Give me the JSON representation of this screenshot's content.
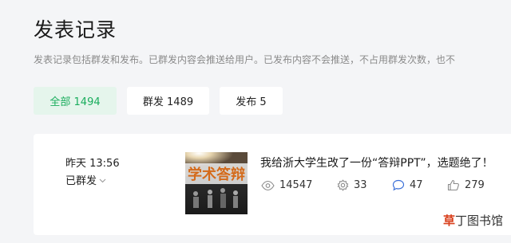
{
  "page": {
    "title": "发表记录",
    "description": "发表记录包括群发和发布。已群发内容会推送给用户。已发布内容不会推送，不占用群发次数，也不"
  },
  "filters": [
    {
      "label": "全部 1494",
      "active": true
    },
    {
      "label": "群发 1489",
      "active": false
    },
    {
      "label": "发布 5",
      "active": false
    }
  ],
  "post": {
    "time": "昨天 13:56",
    "status": "已群发",
    "thumbnail_text": "学术答辩",
    "title": "我给浙大学生改了一份“答辩PPT”，选题绝了！",
    "stats": {
      "reads": "14547",
      "shares": "33",
      "comments": "47",
      "likes": "279"
    }
  },
  "watermark": {
    "first": "草",
    "rest": "丁图书馆"
  },
  "colors": {
    "background": "#f4f5f7",
    "accent_green": "#1aad5d",
    "active_tab_bg": "#e5f5ec",
    "watermark_red": "#d9411e"
  },
  "icons": [
    "eye-icon",
    "share-icon",
    "comment-icon",
    "like-icon",
    "chevron-down-icon"
  ]
}
